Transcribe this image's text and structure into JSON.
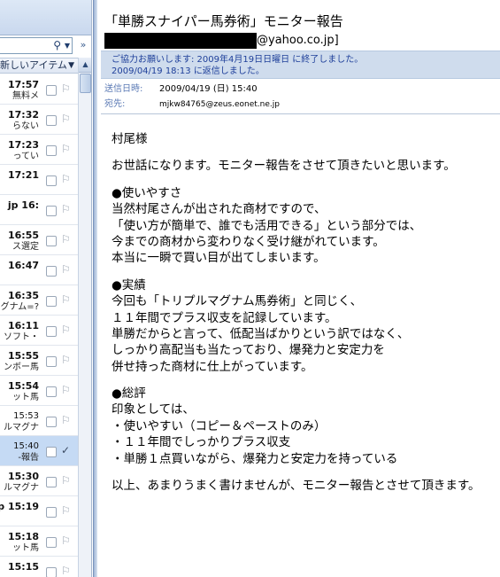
{
  "message_list": {
    "arrange_header": "新しいアイテム",
    "rows": [
      {
        "time": "17:57",
        "subject": "無料メ",
        "read": false,
        "selected": false
      },
      {
        "time": "17:32",
        "subject": "らない",
        "read": false,
        "selected": false
      },
      {
        "time": "17:23",
        "subject": "ってい",
        "read": false,
        "selected": false
      },
      {
        "time": "17:21",
        "subject": "",
        "read": false,
        "selected": false
      },
      {
        "time": "jp 16:",
        "subject": "",
        "read": false,
        "selected": false
      },
      {
        "time": "16:55",
        "subject": "ス選定",
        "read": false,
        "selected": false
      },
      {
        "time": "16:47",
        "subject": "",
        "read": false,
        "selected": false
      },
      {
        "time": "16:35",
        "subject": "グナム=?",
        "read": false,
        "selected": false
      },
      {
        "time": "16:11",
        "subject": "ソフト・",
        "read": false,
        "selected": false
      },
      {
        "time": "15:55",
        "subject": "ンボー馬",
        "read": false,
        "selected": false
      },
      {
        "time": "15:54",
        "subject": "ット馬",
        "read": false,
        "selected": false
      },
      {
        "time": "15:53",
        "subject": "ルマグナ",
        "read": true,
        "selected": false
      },
      {
        "time": "15:40",
        "subject": "-報告",
        "read": true,
        "selected": true
      },
      {
        "time": "15:30",
        "subject": "ルマグナ",
        "read": false,
        "selected": false
      },
      {
        "time": "p 15:19",
        "subject": "",
        "read": false,
        "selected": false
      },
      {
        "time": "15:18",
        "subject": "ット馬",
        "read": false,
        "selected": false
      },
      {
        "time": "15:15",
        "subject": "",
        "read": false,
        "selected": false
      }
    ]
  },
  "reading_pane": {
    "subject": "「単勝スナイパー馬券術」モニター報告",
    "sender_domain": "@yahoo.co.jp]",
    "info_line_1": "ご協力お願いします: 2009年4月19日日曜日 に終了しました。",
    "info_line_2": "2009/04/19 18:13 に返信しました。",
    "sent_label": "送信日時:",
    "sent_value": "2009/04/19 (日) 15:40",
    "to_label": "宛先:",
    "to_value": "mjkw84765@zeus.eonet.ne.jp",
    "body": [
      "村尾様",
      "",
      "お世話になります。モニター報告をさせて頂きたいと思います。",
      "",
      "●使いやすさ",
      "当然村尾さんが出された商材ですので、",
      "「使い方が簡単で、誰でも活用できる」という部分では、",
      "今までの商材から変わりなく受け継がれています。",
      "本当に一瞬で買い目が出てしまいます。",
      "",
      "●実績",
      "今回も「トリプルマグナム馬券術」と同じく、",
      "１１年間でプラス収支を記録しています。",
      "単勝だからと言って、低配当ばかりという訳ではなく、",
      "しっかり高配当も当たっており、爆発力と安定力を",
      "併せ持った商材に仕上がっています。",
      "",
      "●総評",
      "印象としては、",
      "・使いやすい（コピー＆ペーストのみ）",
      "・１１年間でしっかりプラス収支",
      "・単勝１点買いながら、爆発力と安定力を持っている",
      "",
      "以上、あまりうまく書けませんが、モニター報告とさせて頂きます。"
    ]
  },
  "icons": {
    "search": "search-icon",
    "flag": "flag-icon",
    "expand": "expand-icon",
    "scroll_up": "scroll-up-icon"
  },
  "colors": {
    "info_bar_bg": "#cfdced",
    "info_text": "#1e3f9a",
    "selected_row": "#c5daf4",
    "meta_label": "#5a79b4"
  }
}
